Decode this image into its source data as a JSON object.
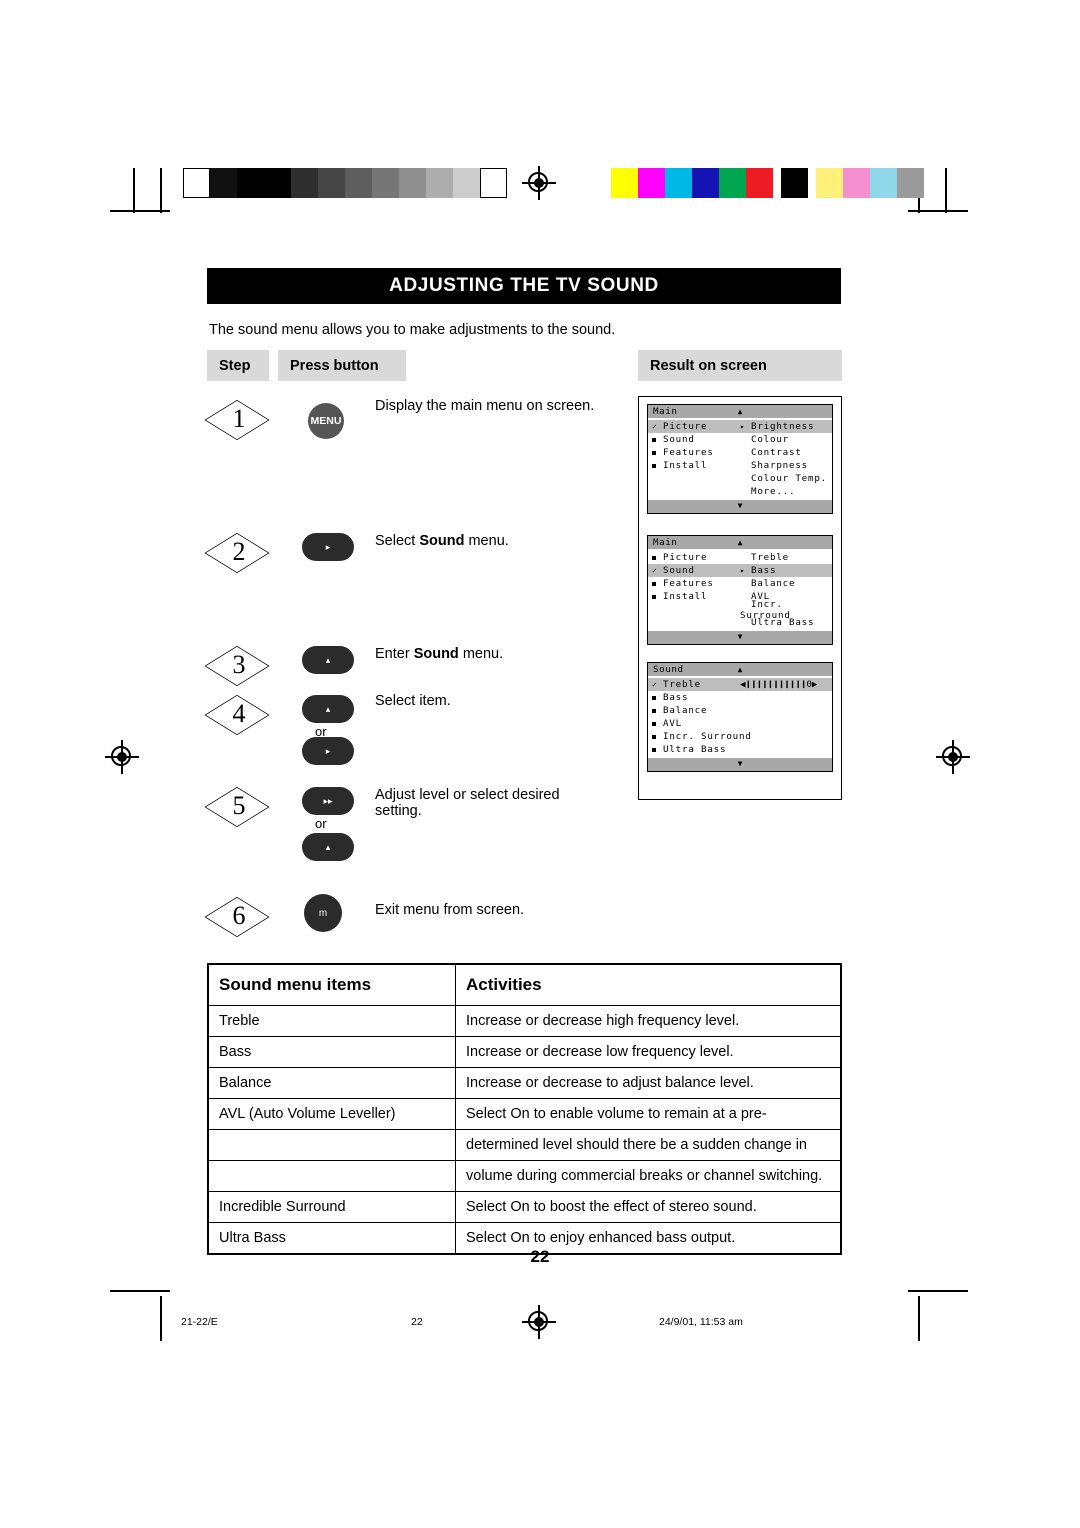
{
  "header": {
    "title_first": "A",
    "title_rest": "DJUSTING THE ",
    "title_tv": "TV S",
    "title_tail": "OUND",
    "title_full": "ADJUSTING THE TV SOUND"
  },
  "intro": "The sound menu allows you to make adjustments to the sound.",
  "table_headers": {
    "step": "Step",
    "press": "Press button",
    "result": "Result on screen"
  },
  "steps": [
    {
      "num": "1",
      "button": "MENU",
      "text_pre": "Display the main menu on screen.",
      "text_b": "",
      "text_post": ""
    },
    {
      "num": "2",
      "button": "▸",
      "text_pre": "Select ",
      "text_b": "Sound",
      "text_post": " menu."
    },
    {
      "num": "3",
      "button": "▴",
      "text_pre": "Enter ",
      "text_b": "Sound",
      "text_post": " menu."
    },
    {
      "num": "4",
      "button": "▴",
      "button2": "▸",
      "or": "or",
      "text_pre": "Select item.",
      "text_b": "",
      "text_post": ""
    },
    {
      "num": "5",
      "button": "▸▸",
      "button2": "▴",
      "or": "or",
      "text_pre": "Adjust level or select desired setting.",
      "text_b": "",
      "text_post": ""
    },
    {
      "num": "6",
      "button": "m",
      "text_pre": "Exit menu from screen.",
      "text_b": "",
      "text_post": ""
    }
  ],
  "osd": {
    "panel1": {
      "title": "Main",
      "left": [
        "Picture",
        "Sound",
        "Features",
        "Install"
      ],
      "right": [
        "Brightness",
        "Colour",
        "Contrast",
        "Sharpness",
        "Colour Temp.",
        "More..."
      ],
      "selected_left": "Picture",
      "selected_right": "Brightness"
    },
    "panel2": {
      "title": "Main",
      "left": [
        "Picture",
        "Sound",
        "Features",
        "Install"
      ],
      "right": [
        "Treble",
        "Bass",
        "Balance",
        "AVL",
        "Incr. Surround",
        "Ultra Bass"
      ],
      "selected_left": "Sound"
    },
    "panel3": {
      "title": "Sound",
      "items": [
        "Treble",
        "Bass",
        "Balance",
        "AVL",
        "Incr. Surround",
        "Ultra Bass"
      ],
      "selected": "Treble",
      "slider": "◀❙❙❙❙❙❙❙❙❙❙❙0▶"
    }
  },
  "sound_table": {
    "header_items": "Sound menu items",
    "header_activities": "Activities",
    "rows": [
      {
        "item": "Treble",
        "activity": "Increase or decrease high frequency level."
      },
      {
        "item": "Bass",
        "activity": "Increase or decrease low frequency level."
      },
      {
        "item": "Balance",
        "activity": "Increase or decrease to adjust balance level."
      },
      {
        "item": "AVL (Auto Volume Leveller)",
        "activity": "Select On to enable volume to remain at a pre-"
      },
      {
        "item": "",
        "activity": "determined level should there be a sudden change in"
      },
      {
        "item": "",
        "activity": "volume during commercial breaks or channel switching."
      },
      {
        "item": "Incredible Surround",
        "activity": "Select On to boost the effect of stereo sound."
      },
      {
        "item": "Ultra Bass",
        "activity": "Select On to enjoy enhanced bass output."
      }
    ]
  },
  "page_number": "22",
  "footer": {
    "left": "21-22/E",
    "center": "22",
    "right": "24/9/01, 11:53 am"
  },
  "marks": {
    "gray_swatches": [
      "#ffffff",
      "#1a1a1a",
      "#000000",
      "#000000",
      "#2b2b2b",
      "#3d3d3d",
      "#575757",
      "#6e6e6e",
      "#8a8a8a",
      "#a3a3a3",
      "#c6c6c6",
      "#e8e8e8",
      "#ffffff"
    ],
    "color_swatches": [
      "#ffff00",
      "#ff00ff",
      "#00ffff",
      "#0000c8",
      "#00a650",
      "#ed1c24",
      "#000000",
      "#fff27a",
      "#f48fd0",
      "#7fd7e8",
      "#9a9a9a"
    ]
  }
}
